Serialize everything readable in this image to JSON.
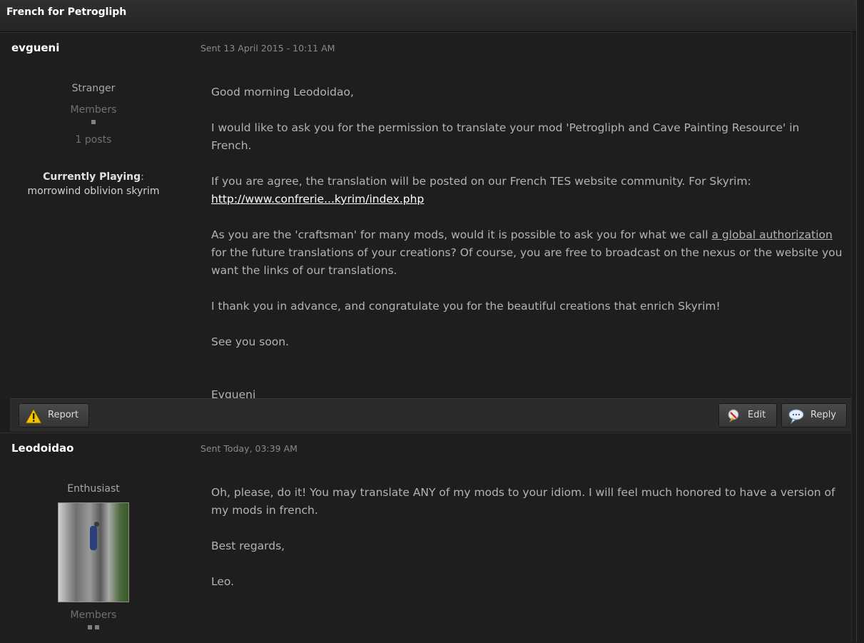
{
  "thread": {
    "title": "French for Petrogliph"
  },
  "posts": [
    {
      "author": "evgueni",
      "date": "Sent 13 April 2015 - 10:11 AM",
      "rank": "Stranger",
      "group": "Members",
      "pips": 1,
      "posts": "1 posts",
      "currently_playing_label": "Currently Playing",
      "currently_playing_colon": ":",
      "currently_playing": "morrowind oblivion skyrim",
      "body": {
        "greeting": "Good morning Leodoidao,",
        "p1": "I would like to ask you for the permission to translate your mod 'Petrogliph and Cave Painting Resource' in French.",
        "p2": "If you are agree, the translation will be posted on our French TES website community. For Skyrim:",
        "p2_link": "http://www.confrerie...kyrim/index.php",
        "p3_before": "As you are the 'craftsman' for many mods, would it is possible to ask you for what we call ",
        "p3_link": "a global authorization",
        "p3_after": " for the future translations of your creations? Of course, you are free to broadcast on the nexus or the website you want the links of our translations.",
        "p4": "I thank you in advance, and congratulate you for the beautiful creations that enrich Skyrim!",
        "p5": "See you soon.",
        "signature": "Evgueni"
      }
    },
    {
      "author": "Leodoidao",
      "date": "Sent Today, 03:39 AM",
      "rank": "Enthusiast",
      "group": "Members",
      "pips": 2,
      "body": {
        "p1": "Oh, please, do it! You may translate ANY of my mods to your idiom. I will feel much honored to have a version of my mods in french.",
        "p2": "Best regards,",
        "p3": "Leo."
      }
    }
  ],
  "actions": {
    "report": "Report",
    "edit": "Edit",
    "reply": "Reply"
  },
  "icons": {
    "report": "warning-icon",
    "edit": "edit-icon",
    "reply": "reply-icon"
  }
}
